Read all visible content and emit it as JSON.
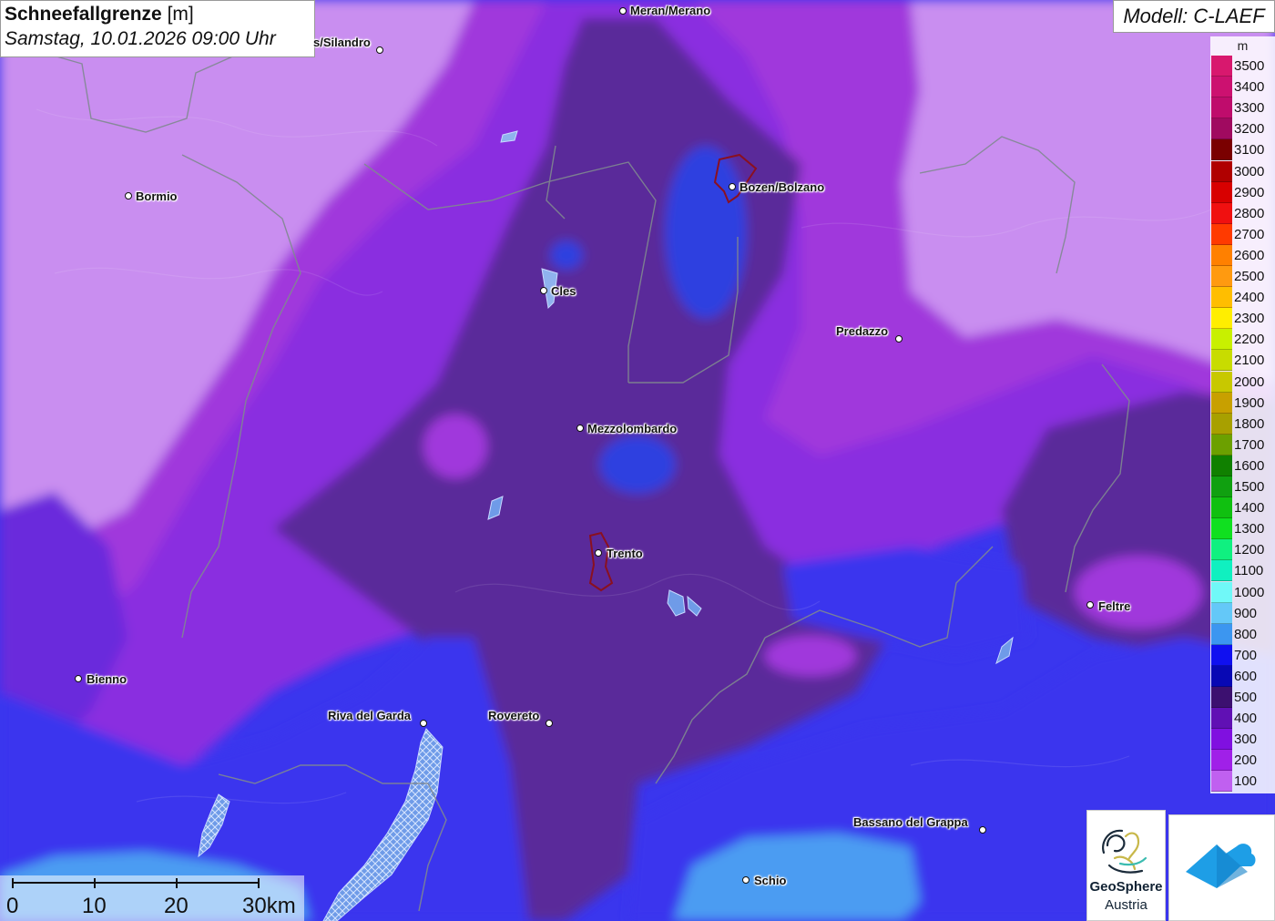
{
  "title": {
    "parameter": "Schneefallgrenze",
    "unit": "[m]",
    "datetime": "Samstag, 10.01.2026 09:00 Uhr"
  },
  "model_label": "Modell: C-LAEF",
  "legend": {
    "unit": "m",
    "entries": [
      {
        "value": "3500",
        "color": "#d8186e"
      },
      {
        "value": "3400",
        "color": "#cc1170"
      },
      {
        "value": "3300",
        "color": "#bf0c6c"
      },
      {
        "value": "3200",
        "color": "#a00a60"
      },
      {
        "value": "3100",
        "color": "#7a0000"
      },
      {
        "value": "3000",
        "color": "#b00000"
      },
      {
        "value": "2900",
        "color": "#d80000"
      },
      {
        "value": "2800",
        "color": "#f01010"
      },
      {
        "value": "2700",
        "color": "#ff3a00"
      },
      {
        "value": "2600",
        "color": "#ff8000"
      },
      {
        "value": "2500",
        "color": "#ff9a10"
      },
      {
        "value": "2400",
        "color": "#ffbe00"
      },
      {
        "value": "2300",
        "color": "#ffee00"
      },
      {
        "value": "2200",
        "color": "#c8f000"
      },
      {
        "value": "2100",
        "color": "#c8dc00"
      },
      {
        "value": "2000",
        "color": "#c8c800"
      },
      {
        "value": "1900",
        "color": "#c8a000"
      },
      {
        "value": "1800",
        "color": "#a8a000"
      },
      {
        "value": "1700",
        "color": "#6ca000"
      },
      {
        "value": "1600",
        "color": "#108000"
      },
      {
        "value": "1500",
        "color": "#10a010"
      },
      {
        "value": "1400",
        "color": "#10c010"
      },
      {
        "value": "1300",
        "color": "#10e020"
      },
      {
        "value": "1200",
        "color": "#10f080"
      },
      {
        "value": "1100",
        "color": "#10f0c0"
      },
      {
        "value": "1000",
        "color": "#70f8f8"
      },
      {
        "value": "900",
        "color": "#64c8f8"
      },
      {
        "value": "800",
        "color": "#3c96f0"
      },
      {
        "value": "700",
        "color": "#1010f0"
      },
      {
        "value": "600",
        "color": "#0808b4"
      },
      {
        "value": "500",
        "color": "#3c1070"
      },
      {
        "value": "400",
        "color": "#6010b4"
      },
      {
        "value": "300",
        "color": "#8010e0"
      },
      {
        "value": "200",
        "color": "#a020e8"
      },
      {
        "value": "100",
        "color": "#c060f0"
      }
    ]
  },
  "cities": [
    {
      "name": "Meran/Merano"
    },
    {
      "name": "s/Silandro"
    },
    {
      "name": "Bormio"
    },
    {
      "name": "Bozen/Bolzano"
    },
    {
      "name": "Cles"
    },
    {
      "name": "Predazzo"
    },
    {
      "name": "Mezzolombardo"
    },
    {
      "name": "Trento"
    },
    {
      "name": "Feltre"
    },
    {
      "name": "Bienno"
    },
    {
      "name": "Riva del Garda"
    },
    {
      "name": "Rovereto"
    },
    {
      "name": "Bassano del Grappa"
    },
    {
      "name": "Schio"
    }
  ],
  "scale_bar": {
    "labels": [
      "0",
      "10",
      "20",
      "30km"
    ]
  },
  "logo": {
    "line1": "GeoSphere",
    "line2": "Austria"
  },
  "colors": {
    "very_light_purple": "#c98ef0",
    "light_purple": "#b267ec",
    "magenta_purple": "#a038dc",
    "medium_purple": "#8a2ee0",
    "violet": "#6a2adc",
    "dark_purple": "#5a2a9a",
    "blue": "#3a36ee",
    "light_blue": "#4b9cf2"
  }
}
